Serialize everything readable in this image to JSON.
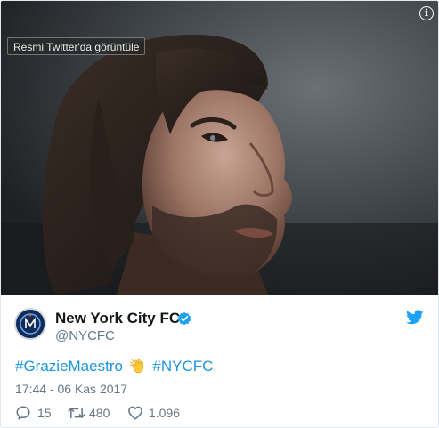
{
  "media": {
    "view_on_twitter_label": "Resmi Twitter'da görüntüle",
    "info_icon": "info-icon"
  },
  "author": {
    "display_name": "New York City FC",
    "handle": "@NYCFC",
    "verified_icon": "verified-badge-icon",
    "avatar_icon": "nycfc-crest"
  },
  "platform_icon": "twitter-bird-icon",
  "tweet": {
    "hashtag_1": "#GrazieMaestro",
    "emoji": "clapping-hands-emoji",
    "hashtag_2": "#NYCFC",
    "timestamp": "17:44 - 06 Kas 2017"
  },
  "actions": {
    "replies": "15",
    "retweets": "480",
    "likes": "1.096"
  },
  "colors": {
    "link": "#1b95e0",
    "secondary_text": "#657786",
    "primary_text": "#14171a",
    "verified": "#1da1f2"
  }
}
